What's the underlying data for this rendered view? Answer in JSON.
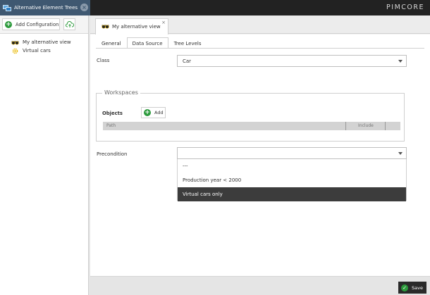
{
  "header": {
    "panel_title": "Alternative Element Trees",
    "brand": "PIMCORE"
  },
  "sidebar": {
    "add_config_label": "Add Configuration",
    "items": [
      {
        "label": "My alternative view",
        "icon": "glasses-icon"
      },
      {
        "label": "Virtual cars",
        "icon": "gear-icon"
      }
    ]
  },
  "document_tab": {
    "label": "My alternative view"
  },
  "sub_tabs": [
    "General",
    "Data Source",
    "Tree Levels"
  ],
  "form": {
    "class_label": "Class",
    "class_value": "Car",
    "workspaces_legend": "Workspaces",
    "objects_label": "Objects",
    "add_label": "Add",
    "grid_col_path": "Path",
    "grid_col_include": "Include",
    "precondition_label": "Precondition",
    "precondition_value": ""
  },
  "dropdown_options": [
    "---",
    "Production year < 2000",
    "Virtual cars only"
  ],
  "footer": {
    "save_label": "Save"
  },
  "colors": {
    "accent_green": "#2c9a3c",
    "panel_tab_bg": "#3f5871",
    "topbar_bg": "#222222",
    "highlight_row": "#3c3c3c"
  }
}
